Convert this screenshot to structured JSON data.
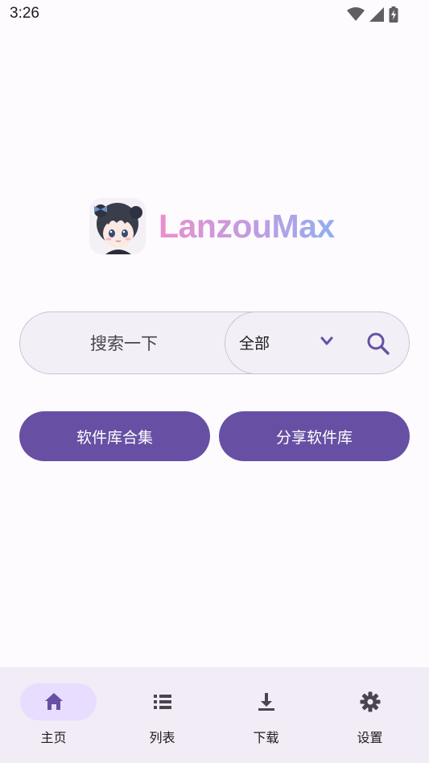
{
  "status_bar": {
    "time": "3:26",
    "icons": [
      "wifi-icon",
      "signal-icon",
      "battery-charging-icon"
    ]
  },
  "app": {
    "name": "LanzouMax",
    "logo": "anime-avatar-logo"
  },
  "search": {
    "placeholder": "搜索一下",
    "category": "全部"
  },
  "actions": {
    "left_label": "软件库合集",
    "right_label": "分享软件库"
  },
  "bottom_nav": {
    "items": [
      {
        "label": "主页",
        "icon": "home-icon",
        "active": true
      },
      {
        "label": "列表",
        "icon": "list-icon",
        "active": false
      },
      {
        "label": "下载",
        "icon": "download-icon",
        "active": false
      },
      {
        "label": "设置",
        "icon": "settings-icon",
        "active": false
      }
    ]
  },
  "colors": {
    "primary": "#6750a4",
    "background": "#fefbff",
    "nav_background": "#f2ecf6",
    "active_pill": "#e8ddff",
    "title_gradient": [
      "#f08fc8",
      "#c69be0",
      "#8cb2f0"
    ]
  }
}
